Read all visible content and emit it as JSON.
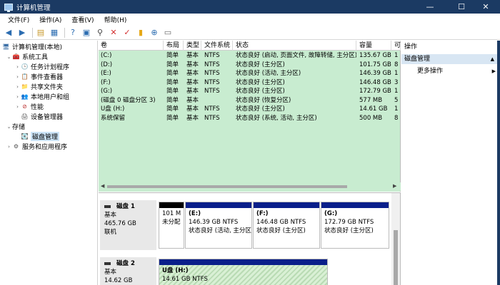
{
  "window": {
    "title": "计算机管理",
    "minimize": "—",
    "maximize": "☐",
    "close": "✕"
  },
  "menu": [
    "文件(F)",
    "操作(A)",
    "查看(V)",
    "帮助(H)"
  ],
  "tree": [
    {
      "label": "计算机管理(本地)",
      "chev": "",
      "icon": "🖥"
    },
    {
      "label": "系统工具",
      "chev": "⌄",
      "icon": "🧰"
    },
    {
      "label": "任务计划程序",
      "chev": "›",
      "icon": "🕒"
    },
    {
      "label": "事件查看器",
      "chev": "›",
      "icon": "📋"
    },
    {
      "label": "共享文件夹",
      "chev": "›",
      "icon": "📁"
    },
    {
      "label": "本地用户和组",
      "chev": "›",
      "icon": "👥"
    },
    {
      "label": "性能",
      "chev": "›",
      "icon": "⊘"
    },
    {
      "label": "设备管理器",
      "chev": "",
      "icon": "🖨"
    },
    {
      "label": "存储",
      "chev": "⌄",
      "icon": ""
    },
    {
      "label": "磁盘管理",
      "chev": "",
      "icon": "💽"
    },
    {
      "label": "服务和应用程序",
      "chev": "›",
      "icon": "⚙"
    }
  ],
  "volumes": {
    "headers": [
      "卷",
      "布局",
      "类型",
      "文件系统",
      "状态",
      "容量",
      "可"
    ],
    "rows": [
      [
        "(C:)",
        "简单",
        "基本",
        "NTFS",
        "状态良好 (启动, 页面文件, 故障转储, 主分区)",
        "135.67 GB",
        "1"
      ],
      [
        "(D:)",
        "简单",
        "基本",
        "NTFS",
        "状态良好 (主分区)",
        "101.75 GB",
        "8"
      ],
      [
        "(E:)",
        "简单",
        "基本",
        "NTFS",
        "状态良好 (活动, 主分区)",
        "146.39 GB",
        "1"
      ],
      [
        "(F:)",
        "简单",
        "基本",
        "NTFS",
        "状态良好 (主分区)",
        "146.48 GB",
        "3"
      ],
      [
        "(G:)",
        "简单",
        "基本",
        "NTFS",
        "状态良好 (主分区)",
        "172.79 GB",
        "1"
      ],
      [
        "(磁盘 0 磁盘分区 3)",
        "简单",
        "基本",
        "",
        "状态良好 (恢复分区)",
        "577 MB",
        "5"
      ],
      [
        "U盘 (H:)",
        "简单",
        "基本",
        "NTFS",
        "状态良好 (主分区)",
        "14.61 GB",
        "1"
      ],
      [
        "系统保留",
        "简单",
        "基本",
        "NTFS",
        "状态良好 (系统, 活动, 主分区)",
        "500 MB",
        "8"
      ]
    ]
  },
  "disks": [
    {
      "name": "磁盘 1",
      "type": "基本",
      "size": "465.76 GB",
      "status": "联机",
      "partitions": [
        {
          "name": "",
          "line1": "101 M",
          "line2": "未分配"
        },
        {
          "name": "(E:)",
          "line1": "146.39 GB NTFS",
          "line2": "状态良好 (活动, 主分区)"
        },
        {
          "name": "(F:)",
          "line1": "146.48 GB NTFS",
          "line2": "状态良好 (主分区)"
        },
        {
          "name": "(G:)",
          "line1": "172.79 GB NTFS",
          "line2": "状态良好 (主分区)"
        }
      ]
    },
    {
      "name": "磁盘 2",
      "type": "基本",
      "size": "14.62 GB",
      "partitions": [
        {
          "name": "U盘 (H:)",
          "line1": "14.61 GB NTFS"
        }
      ]
    }
  ],
  "actions": {
    "header": "操作",
    "section": "磁盘管理",
    "more": "更多操作",
    "section_arrow": "▲",
    "more_arrow": "▶"
  },
  "colors": {
    "titlebar": "#1b3a63",
    "volume_bg": "#c8ecd0",
    "partition_bar": "#0a1f8a",
    "unallocated_bar": "#000000",
    "action_section": "#d8e6f3"
  }
}
